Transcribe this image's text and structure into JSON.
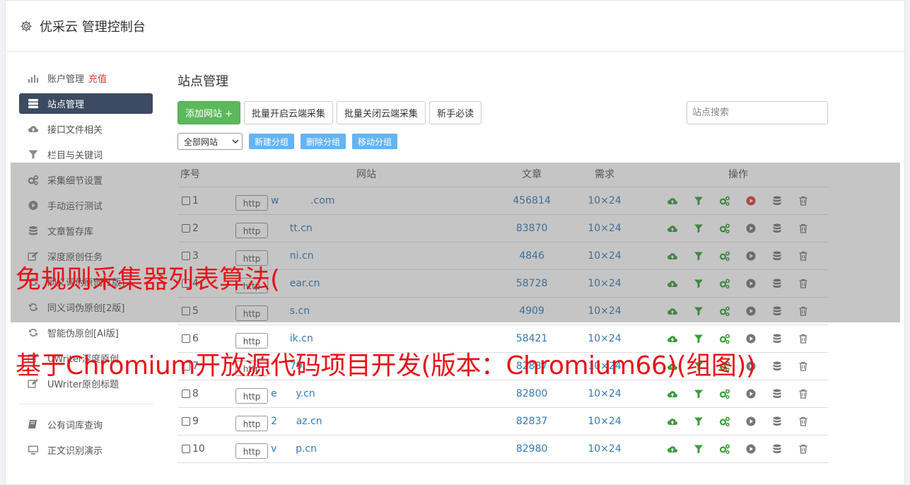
{
  "header": {
    "title": "优采云 管理控制台",
    "icon": "gear-icon"
  },
  "sidebar": {
    "items": [
      {
        "label": "账户管理",
        "extra": "充值",
        "icon": "bar-chart-icon",
        "active": false
      },
      {
        "label": "站点管理",
        "extra": "",
        "icon": "server-icon",
        "active": true
      },
      {
        "label": "接口文件相关",
        "extra": "",
        "icon": "cloud-upload-icon",
        "active": false
      },
      {
        "label": "栏目与关键词",
        "extra": "",
        "icon": "filter-icon",
        "active": false
      },
      {
        "label": "采集细节设置",
        "extra": "",
        "icon": "cogs-icon",
        "active": false
      },
      {
        "label": "手动运行测试",
        "extra": "",
        "icon": "play-circle-icon",
        "active": false
      },
      {
        "label": "文章暂存库",
        "extra": "",
        "icon": "database-icon",
        "active": false
      },
      {
        "label": "深度原创任务",
        "extra": "",
        "icon": "edit-icon",
        "active": false
      },
      {
        "label": "同义词伪原创[1版]",
        "extra": "",
        "icon": "refresh-icon",
        "active": false
      },
      {
        "label": "同义词伪原创[2版]",
        "extra": "",
        "icon": "refresh-icon",
        "active": false
      },
      {
        "label": "智能伪原创[AI版]",
        "extra": "",
        "icon": "refresh-icon",
        "active": false
      },
      {
        "label": "UWriter深度原创",
        "extra": "",
        "icon": "edit-icon",
        "active": false
      },
      {
        "label": "UWriter原创标题",
        "extra": "",
        "icon": "edit-icon",
        "active": false
      }
    ],
    "bottom_items": [
      {
        "label": "公有词库查询",
        "icon": "book-icon"
      },
      {
        "label": "正文识别演示",
        "icon": "monitor-icon"
      }
    ]
  },
  "main": {
    "title": "站点管理",
    "add_site_label": "添加网站 +",
    "batch_open_label": "批量开启云端采集",
    "batch_close_label": "批量关闭云端采集",
    "newbie_label": "新手必读",
    "search_placeholder": "站点搜索",
    "group_select_value": "全部网站",
    "new_group_label": "新建分组",
    "delete_group_label": "删除分组",
    "move_group_label": "移动分组"
  },
  "table": {
    "headers": {
      "index": "序号",
      "site": "网站",
      "articles": "文章",
      "demand": "需求",
      "actions": "操作"
    },
    "rows": [
      {
        "index": "1",
        "scheme": "http",
        "site": "w          .com",
        "articles": "456814",
        "demand": "10×24",
        "running": true
      },
      {
        "index": "2",
        "scheme": "http",
        "site": "      tt.cn",
        "articles": "83870",
        "demand": "10×24",
        "running": false
      },
      {
        "index": "3",
        "scheme": "http",
        "site": "      ni.cn",
        "articles": "4846",
        "demand": "10×24",
        "running": false
      },
      {
        "index": "4",
        "scheme": "http",
        "site": "      ear.cn",
        "articles": "58728",
        "demand": "10×24",
        "running": false
      },
      {
        "index": "5",
        "scheme": "http",
        "site": "      s.cn",
        "articles": "4909",
        "demand": "10×24",
        "running": false
      },
      {
        "index": "6",
        "scheme": "http",
        "site": "      ik.cn",
        "articles": "58421",
        "demand": "10×24",
        "running": false
      },
      {
        "index": "7",
        "scheme": "http",
        "site": "      79.",
        "articles": "82887",
        "demand": "10×24",
        "running": false
      },
      {
        "index": "8",
        "scheme": "http",
        "site": "e      y.cn",
        "articles": "82800",
        "demand": "10×24",
        "running": false
      },
      {
        "index": "9",
        "scheme": "http",
        "site": "2      az.cn",
        "articles": "82837",
        "demand": "10×24",
        "running": false
      },
      {
        "index": "10",
        "scheme": "http",
        "site": "v      p.cn",
        "articles": "82980",
        "demand": "10×24",
        "running": false
      }
    ]
  },
  "watermark": {
    "line1": "免规则采集器列表算法(",
    "line2": "基于Chromium开放源代码项目开发(版本：Chromium66)(组图))"
  },
  "colors": {
    "accent_green": "#5cb85c",
    "sidebar_active": "#3c4a62",
    "link_blue": "#337ab7",
    "watermark_red": "#e8121a"
  }
}
